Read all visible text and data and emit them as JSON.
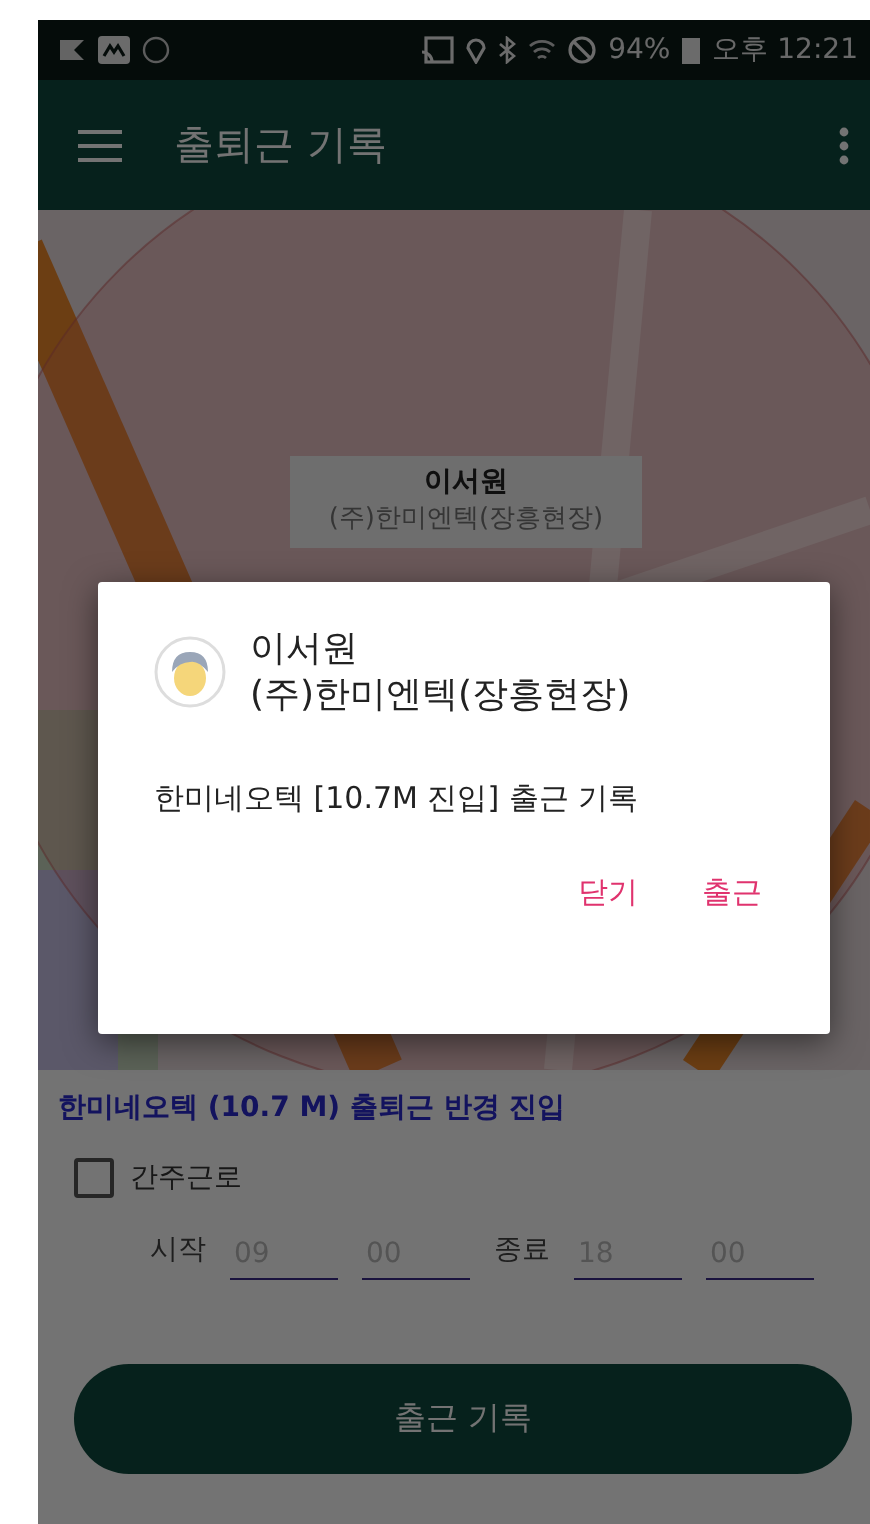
{
  "status_bar": {
    "battery": "94%",
    "time": "오후 12:21"
  },
  "app_bar": {
    "title": "출퇴근 기록"
  },
  "map": {
    "marker": {
      "name": "이서원",
      "company": "(주)한미엔텍(장흥현장)"
    }
  },
  "geofence_notice": "한미네오텍 (10.7 M) 출퇴근 반경 진입",
  "deemed_work": {
    "label": "간주근로",
    "checked": false
  },
  "hours": {
    "start_label": "시작",
    "start_hour": {
      "placeholder": "09"
    },
    "start_minute": {
      "placeholder": "00"
    },
    "end_label": "종료",
    "end_hour": {
      "placeholder": "18"
    },
    "end_minute": {
      "placeholder": "00"
    }
  },
  "primary_button": "출근 기록",
  "dialog": {
    "name": "이서원",
    "company": "(주)한미엔텍(장흥현장)",
    "message": "한미네오텍 [10.7M 진입] 출근 기록",
    "buttons": [
      "닫기",
      "출근"
    ]
  }
}
